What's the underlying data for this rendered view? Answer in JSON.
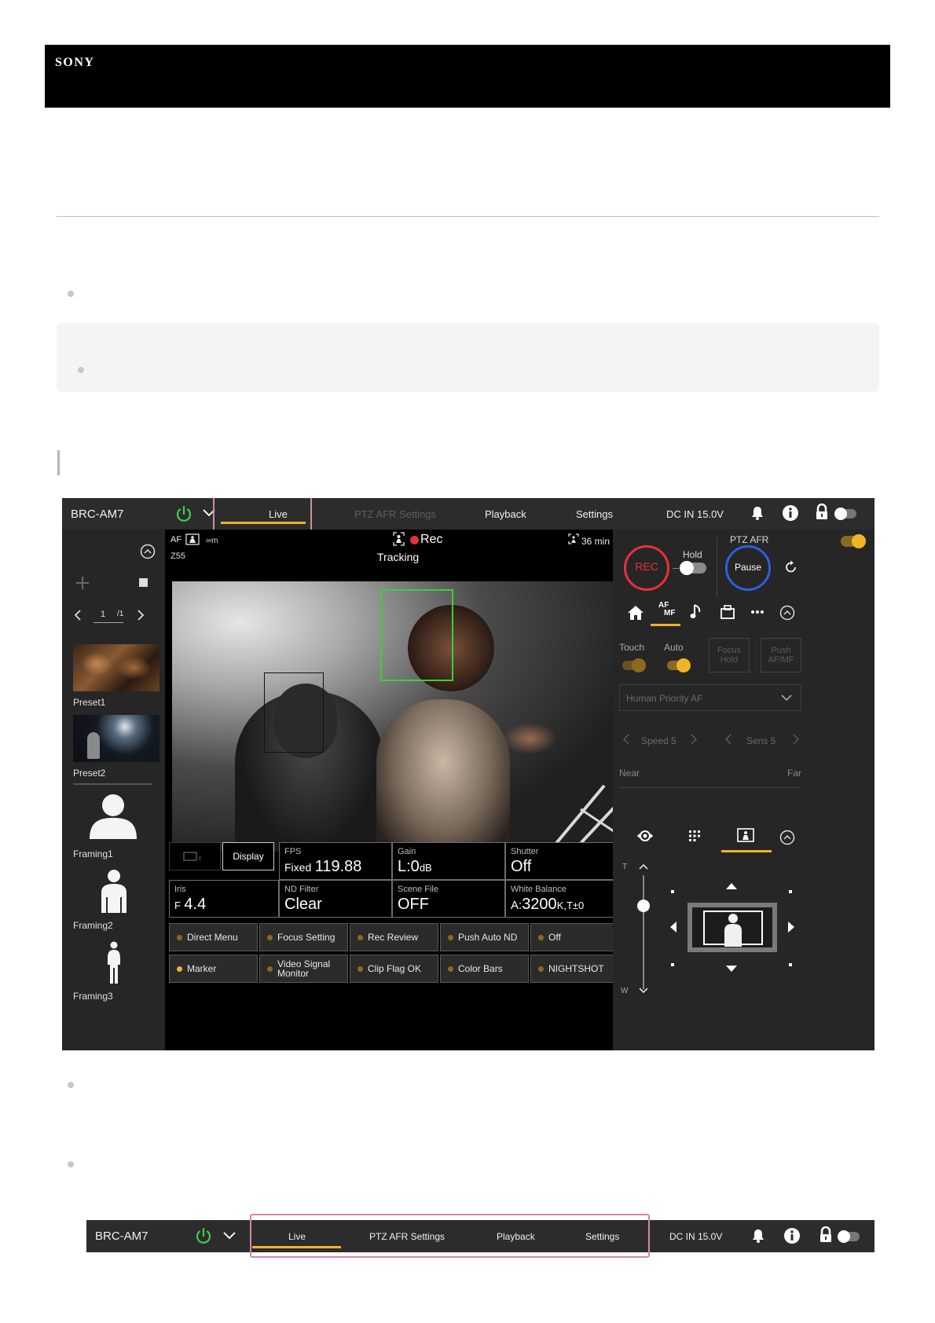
{
  "brand": {
    "logo_text": "SONY"
  },
  "app": {
    "device_name": "BRC-AM7",
    "tabs": [
      {
        "label": "Live",
        "active": true
      },
      {
        "label": "PTZ AFR Settings",
        "active": false
      },
      {
        "label": "Playback",
        "active": false
      },
      {
        "label": "Settings",
        "active": false
      }
    ],
    "power_status": "DC IN 15.0V",
    "accent_color": "#f0b429",
    "sidebar": {
      "page_number": "1",
      "page_total": "/1",
      "presets": [
        {
          "label": "Preset1"
        },
        {
          "label": "Preset2"
        }
      ],
      "framings": [
        {
          "label": "Framing1"
        },
        {
          "label": "Framing2"
        },
        {
          "label": "Framing3"
        }
      ]
    },
    "viewer": {
      "af_label": "AF",
      "focus_distance": "∞m",
      "zoom": "Z55",
      "rec_label": "Rec",
      "tracking_label": "Tracking",
      "remaining_time": "36 min"
    },
    "status": {
      "display_button": "Display",
      "fps": {
        "label": "FPS",
        "prefix": "Fixed",
        "value": "119.88"
      },
      "gain": {
        "label": "Gain",
        "value": "L:0",
        "unit": "dB"
      },
      "shutter": {
        "label": "Shutter",
        "value": "Off"
      },
      "iris": {
        "label": "Iris",
        "prefix": "F",
        "value": "4.4"
      },
      "nd_filter": {
        "label": "ND Filter",
        "value": "Clear"
      },
      "scene_file": {
        "label": "Scene File",
        "value": "OFF"
      },
      "white_balance": {
        "label": "White Balance",
        "prefix": "A:",
        "value": "3200",
        "suffix": "K,T±0"
      }
    },
    "assign_buttons": [
      {
        "label": "Direct Menu",
        "active": false
      },
      {
        "label": "Focus Setting",
        "active": false
      },
      {
        "label": "Rec Review",
        "active": false
      },
      {
        "label": "Push Auto ND",
        "active": false
      },
      {
        "label": "Off",
        "active": false
      },
      {
        "label": "Marker",
        "active": true
      },
      {
        "label": "Video Signal Monitor",
        "active": false
      },
      {
        "label": "Clip Flag OK",
        "active": false
      },
      {
        "label": "Color Bars",
        "active": false
      },
      {
        "label": "NIGHTSHOT",
        "active": false
      }
    ],
    "right_panel": {
      "ptz_afr_label": "PTZ AFR",
      "hold_label": "Hold",
      "rec_button": "REC",
      "pause_button": "Pause",
      "af_mf_tab_top": "AF",
      "af_mf_tab_bottom": "MF",
      "touch_label": "Touch",
      "auto_label": "Auto",
      "focus_hold_button": "Focus Hold",
      "push_af_mf_button": "Push AF/MF",
      "af_mode_select": "Human Priority AF",
      "speed_label": "Speed 5",
      "sens_label": "Sens 5",
      "near_label": "Near",
      "far_label": "Far",
      "tele_label": "T",
      "wide_label": "W"
    }
  },
  "app_bar_closeup": {
    "device_name": "BRC-AM7",
    "tabs": [
      "Live",
      "PTZ AFR Settings",
      "Playback",
      "Settings"
    ],
    "power_status": "DC IN 15.0V"
  }
}
